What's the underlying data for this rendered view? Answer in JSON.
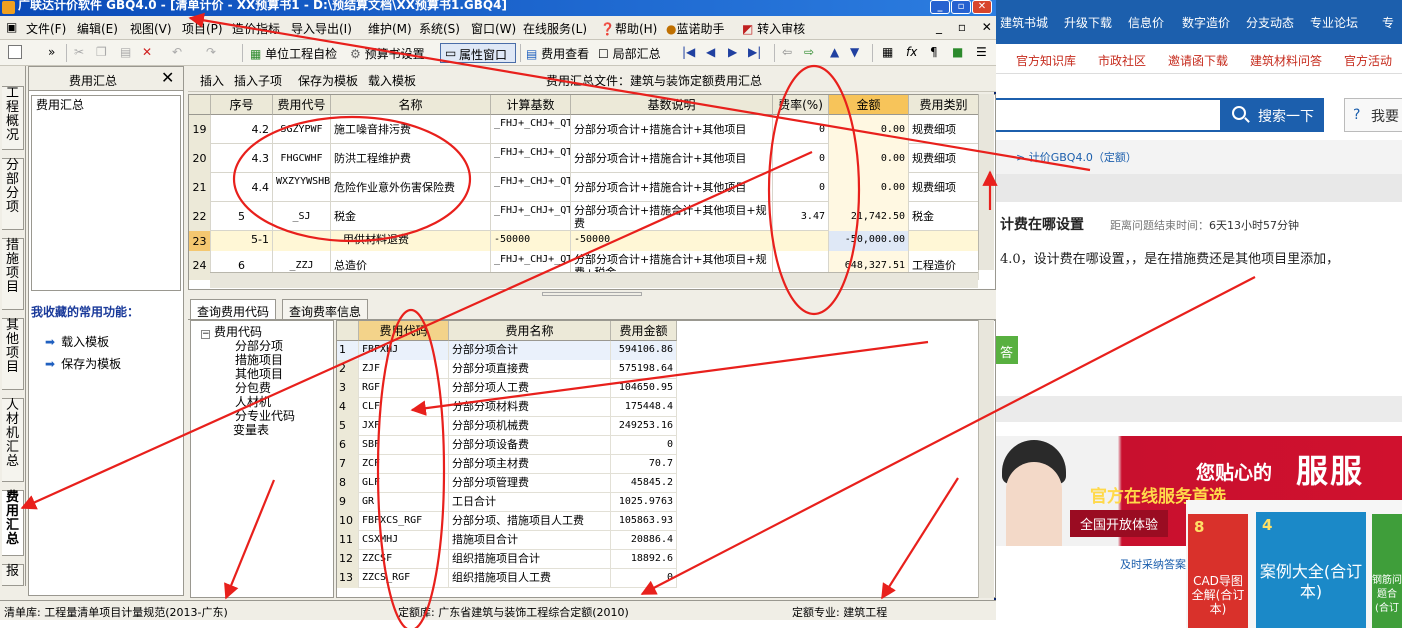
{
  "web": {
    "nav": [
      "建筑书城",
      "升级下载",
      "信息价",
      "数字造价",
      "分支动态",
      "专业论坛",
      "专"
    ],
    "sub": [
      "官方知识库",
      "市政社区",
      "邀请函下载",
      "建筑材料问答",
      "官方活动"
    ],
    "search_label": "搜索一下",
    "ask_label": "我要",
    "crumb": "> 计价GBQ4.0（定额）",
    "question_title": "计费在哪设置",
    "question_time_label": "距离问题结束时间：",
    "question_time_value": "6天13小时57分钟",
    "question_body": "4.0，设计费在哪设置，，是在措施费还是其他项目里添加，",
    "answer_btn": "答",
    "banner_line1": "您贴心的",
    "banner_line2": "官方在线服务首选",
    "banner_line3": "全国开放体验",
    "banner_big": "服服",
    "promo": "及时采纳答案",
    "books": [
      {
        "rank": "8",
        "name": "CAD导图全解(合订本)"
      },
      {
        "rank": "4",
        "name": "案例大全(合订本)"
      },
      {
        "rank": "",
        "name": "钢筋问题合(合订"
      }
    ]
  },
  "app": {
    "title": "广联达计价软件 GBQ4.0 - [清单计价 - XX预算书1 - D:\\预结算文档\\XX预算书1.GBQ4]",
    "menu": [
      "文件(F)",
      "编辑(E)",
      "视图(V)",
      "项目(P)",
      "造价指标",
      "导入导出(I)",
      "维护(M)",
      "系统(S)",
      "窗口(W)",
      "在线服务(L)",
      "帮助(H)",
      "蓝诺助手",
      "转入审核"
    ],
    "mdi_controls": "_ ▫ ✕",
    "toolbar": {
      "self_check": "单位工程自检",
      "budget_settings": "预算书设置",
      "attr_window": "属性窗口",
      "fee_view": "费用查看",
      "local_summary": "局部汇总"
    },
    "vtabs": [
      "工程概况",
      "分部分项",
      "措施项目",
      "其他项目",
      "人材机汇总",
      "费用汇总",
      "报"
    ],
    "left_panel": {
      "title": "费用汇总",
      "tree_node": "费用汇总",
      "fav_title": "我收藏的常用功能：",
      "fav_items": [
        "载入模板",
        "保存为模板"
      ]
    },
    "ctx_bar": {
      "buttons": [
        "插入",
        "插入子项",
        "保存为模板",
        "载入模板"
      ],
      "file_label": "费用汇总文件：建筑与装饰定额费用汇总"
    },
    "grid": {
      "headers": [
        "序号",
        "费用代号",
        "名称",
        "计算基数",
        "基数说明",
        "费率(%)",
        "金额",
        "费用类别"
      ],
      "rows": [
        {
          "rn": "19",
          "seq": "4.2",
          "code": "SGZYPWF",
          "name": "施工噪音排污费",
          "base": "_FHJ+_CHJ+_QTXM",
          "desc": "分部分项合计+措施合计+其他项目",
          "rate": "0",
          "amount": "0.00",
          "type": "规费细项"
        },
        {
          "rn": "20",
          "seq": "4.3",
          "code": "FHGCWHF",
          "name": "防洪工程维护费",
          "base": "_FHJ+_CHJ+_QTXM",
          "desc": "分部分项合计+措施合计+其他项目",
          "rate": "0",
          "amount": "0.00",
          "type": "规费细项"
        },
        {
          "rn": "21",
          "seq": "4.4",
          "code": "WXZYYWSHBXF",
          "name": "危险作业意外伤害保险费",
          "base": "_FHJ+_CHJ+_QTXM",
          "desc": "分部分项合计+措施合计+其他项目",
          "rate": "0",
          "amount": "0.00",
          "type": "规费细项"
        },
        {
          "rn": "22",
          "seq": "5",
          "code": "_SJ",
          "name": "税金",
          "base": "_FHJ+_CHJ+_QTXM+_GF",
          "desc": "分部分项合计+措施合计+其他项目+规费",
          "rate": "3.47",
          "amount": "21,742.50",
          "type": "税金"
        },
        {
          "rn": "23",
          "seq": "5-1",
          "code": "",
          "name": "甲供材料退费",
          "base": "-50000",
          "desc": "-50000",
          "rate": "",
          "amount": "-50,000.00",
          "type": ""
        },
        {
          "rn": "24",
          "seq": "6",
          "code": "_ZZJ",
          "name": "总造价",
          "base": "_FHJ+_CHJ+_QTXM+_GF+_SJ",
          "desc": "分部分项合计+措施合计+其他项目+规费+税金",
          "rate": "",
          "amount": "648,327.51",
          "type": "工程造价"
        }
      ]
    },
    "bottom_tabs": [
      "查询费用代码",
      "查询费率信息"
    ],
    "bottom_tree": {
      "root": "费用代码",
      "items": [
        "分部分项",
        "措施项目",
        "其他项目",
        "分包费",
        "人材机",
        "分专业代码",
        "变量表"
      ]
    },
    "code_table": {
      "headers": [
        "费用代码",
        "费用名称",
        "费用金额"
      ],
      "rows": [
        {
          "rn": "1",
          "code": "FBFXHJ",
          "name": "分部分项合计",
          "amount": "594106.86"
        },
        {
          "rn": "2",
          "code": "ZJF",
          "name": "分部分项直接费",
          "amount": "575198.64"
        },
        {
          "rn": "3",
          "code": "RGF",
          "name": "分部分项人工费",
          "amount": "104650.95"
        },
        {
          "rn": "4",
          "code": "CLF",
          "name": "分部分项材料费",
          "amount": "175448.4"
        },
        {
          "rn": "5",
          "code": "JXF",
          "name": "分部分项机械费",
          "amount": "249253.16"
        },
        {
          "rn": "6",
          "code": "SBF",
          "name": "分部分项设备费",
          "amount": "0"
        },
        {
          "rn": "7",
          "code": "ZCF",
          "name": "分部分项主材费",
          "amount": "70.7"
        },
        {
          "rn": "8",
          "code": "GLF",
          "name": "分部分项管理费",
          "amount": "45845.2"
        },
        {
          "rn": "9",
          "code": "GR",
          "name": "工日合计",
          "amount": "1025.9763"
        },
        {
          "rn": "10",
          "code": "FBFXCS_RGF",
          "name": "分部分项、措施项目人工费",
          "amount": "105863.93"
        },
        {
          "rn": "11",
          "code": "CSXMHJ",
          "name": "措施项目合计",
          "amount": "20886.4"
        },
        {
          "rn": "12",
          "code": "ZZCSF",
          "name": "组织措施项目合计",
          "amount": "18892.6"
        },
        {
          "rn": "13",
          "code": "ZZCS_RGF",
          "name": "组织措施项目人工费",
          "amount": "0"
        }
      ]
    },
    "status": {
      "left": "清单库: 工程量清单项目计量规范(2013-广东)",
      "mid": "定额库: 广东省建筑与装饰工程综合定额(2010)",
      "right": "定额专业: 建筑工程"
    }
  },
  "colors": {
    "annotation": "#e8201c",
    "title_bar": "#0a4ab8",
    "web_nav": "#1c5fad"
  }
}
